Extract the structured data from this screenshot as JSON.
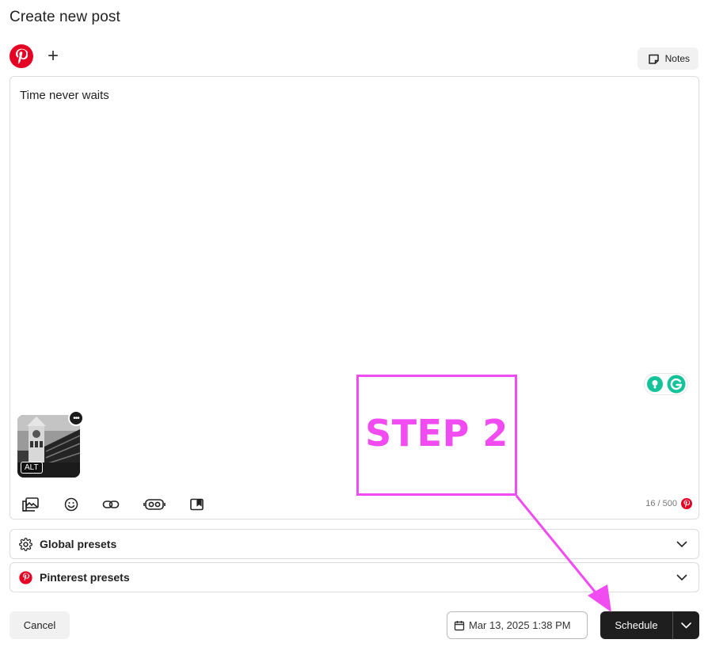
{
  "header": {
    "title": "Create new post"
  },
  "networks": {
    "add_label": "+"
  },
  "notes": {
    "label": "Notes"
  },
  "editor": {
    "text": "Time never waits"
  },
  "media": {
    "alt_label": "ALT",
    "menu_label": "•••"
  },
  "counter": {
    "text": "16 / 500"
  },
  "presets": [
    {
      "label": "Global presets",
      "icon": "gear-icon"
    },
    {
      "label": "Pinterest presets",
      "icon": "pinterest-icon"
    }
  ],
  "footer": {
    "cancel_label": "Cancel",
    "date_label": "Mar 13, 2025 1:38 PM",
    "schedule_label": "Schedule"
  },
  "annotation": {
    "text": "STEP 2",
    "color": "#f04cf2"
  },
  "colors": {
    "pinterest": "#e60023",
    "schedule_bg": "#1e1e1e",
    "grammarly": "#15c39a"
  }
}
